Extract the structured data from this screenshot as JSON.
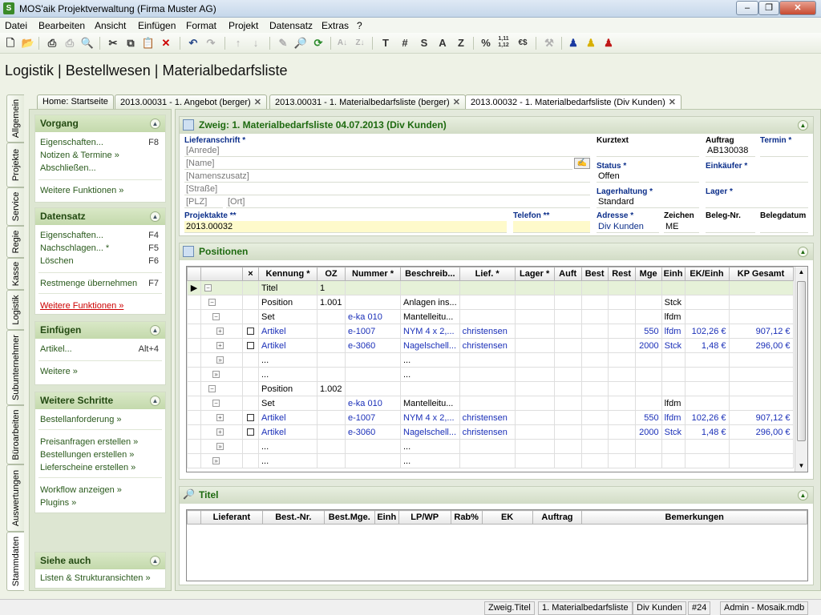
{
  "window": {
    "title": "MOS'aik Projektverwaltung (Firma Muster AG)",
    "app_icon": "S"
  },
  "menu": [
    "Datei",
    "Bearbeiten",
    "Ansicht",
    "Einfügen",
    "Format",
    "Projekt",
    "Datensatz",
    "Extras",
    "?"
  ],
  "toolbar_text": {
    "t": "T",
    "hash": "#",
    "s": "S",
    "a": "A",
    "z": "Z",
    "pct": "%",
    "dec": "1,11\n1,12",
    "cur": "€$"
  },
  "page_title": "Logistik | Bestellwesen | Materialbedarfsliste",
  "tabs": [
    {
      "label": "Home: Startseite"
    },
    {
      "label": "2013.00031 - 1. Angebot (berger)"
    },
    {
      "label": "2013.00031 - 1. Materialbedarfsliste (berger)"
    },
    {
      "label": "2013.00032 - 1. Materialbedarfsliste (Div Kunden)"
    }
  ],
  "vertical_tabs": [
    "Allgemein",
    "Projekte",
    "Service",
    "Regie",
    "Kasse",
    "Logistik",
    "Subunternehmer",
    "Büroarbeiten",
    "Auswertungen",
    "Stammdaten"
  ],
  "sidebar": {
    "vorgang": {
      "title": "Vorgang",
      "items": [
        {
          "label": "Eigenschaften...",
          "key": "F8"
        },
        {
          "label": "Notizen & Termine »"
        },
        {
          "label": "Abschließen..."
        },
        {
          "label": "Weitere Funktionen »"
        }
      ]
    },
    "datensatz": {
      "title": "Datensatz",
      "items": [
        {
          "label": "Eigenschaften...",
          "key": "F4"
        },
        {
          "label": "Nachschlagen... *",
          "key": "F5"
        },
        {
          "label": "Löschen",
          "key": "F6"
        },
        {
          "label": "Restmenge übernehmen",
          "key": "F7"
        },
        {
          "label": "Weitere Funktionen »"
        }
      ]
    },
    "einfuegen": {
      "title": "Einfügen",
      "items": [
        {
          "label": "Artikel...",
          "key": "Alt+4"
        },
        {
          "label": "Weitere »"
        }
      ]
    },
    "weitere": {
      "title": "Weitere Schritte",
      "items": [
        {
          "label": "Bestellanforderung »"
        },
        {
          "label": "Preisanfragen erstellen »"
        },
        {
          "label": "Bestellungen erstellen »"
        },
        {
          "label": "Lieferscheine erstellen »"
        },
        {
          "label": "Workflow anzeigen »"
        },
        {
          "label": "Plugins »"
        }
      ]
    },
    "siehe": {
      "title": "Siehe auch",
      "items": [
        {
          "label": "Listen & Strukturansichten »"
        }
      ]
    }
  },
  "head_panel": {
    "title": "Zweig: 1. Materialbedarfsliste 04.07.2013 (Div Kunden)",
    "lieferanschrift_label": "Lieferanschrift *",
    "anrede": "[Anrede]",
    "name": "[Name]",
    "namenszusatz": "[Namenszusatz]",
    "strasse": "[Straße]",
    "plz": "[PLZ]",
    "ort": "[Ort]",
    "kurztext_label": "Kurztext",
    "kurztext": "",
    "auftrag_label": "Auftrag",
    "auftrag": "AB130038",
    "termin_label": "Termin *",
    "termin": "",
    "status_label": "Status *",
    "status": "Offen",
    "einkaeufer_label": "Einkäufer *",
    "einkaeufer": "",
    "lagerhaltung_label": "Lagerhaltung *",
    "lagerhaltung": "Standard",
    "lager_label": "Lager *",
    "lager": "",
    "projektakte_label": "Projektakte **",
    "projektakte": "2013.00032",
    "telefon_label": "Telefon **",
    "telefon": "",
    "adresse_label": "Adresse *",
    "adresse": "Div Kunden",
    "zeichen_label": "Zeichen",
    "zeichen": "ME",
    "belegnr_label": "Beleg-Nr.",
    "belegnr": "",
    "belegdatum_label": "Belegdatum",
    "belegdatum": ""
  },
  "positions_panel": {
    "title": "Positionen",
    "columns": [
      "",
      "",
      "×",
      "Kennung *",
      "OZ",
      "Nummer *",
      "Beschreib...",
      "Lief. *",
      "Lager *",
      "Auft",
      "Best",
      "Rest",
      "Mge",
      "Einh",
      "EK/Einh",
      "KP Gesamt"
    ],
    "rows": [
      {
        "kennung": "Titel",
        "oz": "1",
        "nummer": "",
        "beschr": "",
        "lief": "",
        "mge": "",
        "einh": "",
        "ek": "",
        "kp": "",
        "chk": false,
        "blue": false
      },
      {
        "kennung": "Position",
        "oz": "1.001",
        "nummer": "",
        "beschr": "Anlagen ins...",
        "lief": "",
        "mge": "",
        "einh": "Stck",
        "ek": "",
        "kp": "",
        "chk": false,
        "blue": false
      },
      {
        "kennung": "Set",
        "oz": "",
        "nummer": "e-ka 010",
        "beschr": "Mantelleitu...",
        "lief": "",
        "mge": "",
        "einh": "lfdm",
        "ek": "",
        "kp": "",
        "chk": false,
        "blue": false
      },
      {
        "kennung": "Artikel",
        "oz": "",
        "nummer": "e-1007",
        "beschr": "NYM 4 x 2,...",
        "lief": "christensen",
        "mge": "550",
        "einh": "lfdm",
        "ek": "102,26 €",
        "kp": "907,12 €",
        "chk": true,
        "blue": true
      },
      {
        "kennung": "Artikel",
        "oz": "",
        "nummer": "e-3060",
        "beschr": "Nagelschell...",
        "lief": "christensen",
        "mge": "2000",
        "einh": "Stck",
        "ek": "1,48 €",
        "kp": "296,00 €",
        "chk": true,
        "blue": true
      },
      {
        "kennung": "...",
        "oz": "",
        "nummer": "",
        "beschr": "...",
        "lief": "",
        "mge": "",
        "einh": "",
        "ek": "",
        "kp": "",
        "chk": false,
        "blue": false
      },
      {
        "kennung": "...",
        "oz": "",
        "nummer": "",
        "beschr": "...",
        "lief": "",
        "mge": "",
        "einh": "",
        "ek": "",
        "kp": "",
        "chk": false,
        "blue": false
      },
      {
        "kennung": "Position",
        "oz": "1.002",
        "nummer": "",
        "beschr": "",
        "lief": "",
        "mge": "",
        "einh": "",
        "ek": "",
        "kp": "",
        "chk": false,
        "blue": false
      },
      {
        "kennung": "Set",
        "oz": "",
        "nummer": "e-ka 010",
        "beschr": "Mantelleitu...",
        "lief": "",
        "mge": "",
        "einh": "lfdm",
        "ek": "",
        "kp": "",
        "chk": false,
        "blue": false
      },
      {
        "kennung": "Artikel",
        "oz": "",
        "nummer": "e-1007",
        "beschr": "NYM 4 x 2,...",
        "lief": "christensen",
        "mge": "550",
        "einh": "lfdm",
        "ek": "102,26 €",
        "kp": "907,12 €",
        "chk": true,
        "blue": true
      },
      {
        "kennung": "Artikel",
        "oz": "",
        "nummer": "e-3060",
        "beschr": "Nagelschell...",
        "lief": "christensen",
        "mge": "2000",
        "einh": "Stck",
        "ek": "1,48 €",
        "kp": "296,00 €",
        "chk": true,
        "blue": true
      },
      {
        "kennung": "...",
        "oz": "",
        "nummer": "",
        "beschr": "...",
        "lief": "",
        "mge": "",
        "einh": "",
        "ek": "",
        "kp": "",
        "chk": false,
        "blue": false
      },
      {
        "kennung": "...",
        "oz": "",
        "nummer": "",
        "beschr": "...",
        "lief": "",
        "mge": "",
        "einh": "",
        "ek": "",
        "kp": "",
        "chk": false,
        "blue": false
      }
    ]
  },
  "titel_panel": {
    "title": "Titel",
    "columns": [
      "",
      "Lieferant",
      "Best.-Nr.",
      "Best.Mge.",
      "Einh",
      "LP/WP",
      "Rab%",
      "EK",
      "Auftrag",
      "Bemerkungen"
    ]
  },
  "statusbar": [
    "Zweig.Titel",
    "1. Materialbedarfsliste",
    "Div Kunden",
    "#24",
    "Admin - Mosaik.mdb"
  ],
  "colors": {
    "accent_green": "#1e6a10",
    "label_blue": "#0b2e8a",
    "row_blue": "#1a2fb8",
    "link_red": "#cc0000"
  }
}
